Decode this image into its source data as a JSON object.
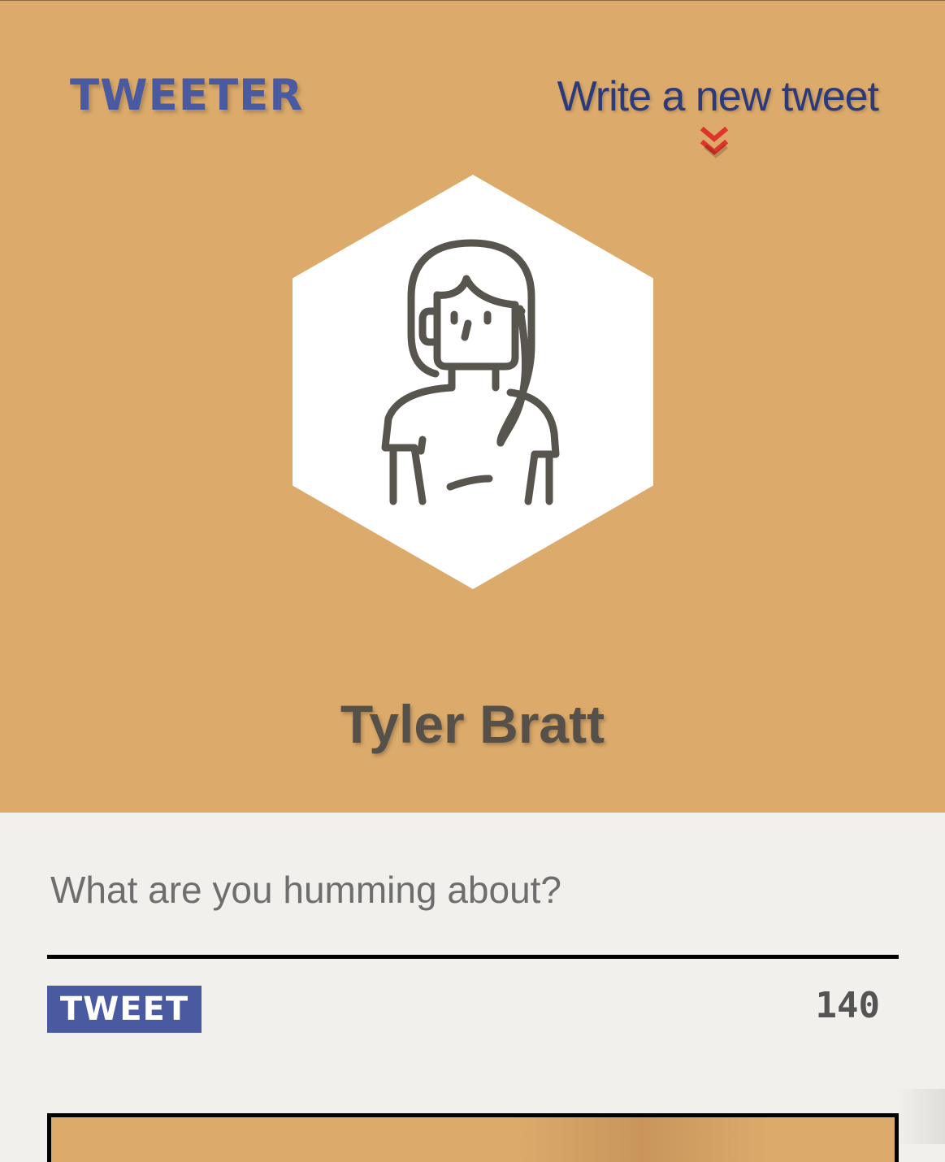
{
  "nav": {
    "logo": "TWEETER",
    "compose_link": "Write a new tweet",
    "compose_icon": "double-chevron-down-icon"
  },
  "profile": {
    "avatar_icon": "woman-avatar-icon",
    "name": "Tyler Bratt"
  },
  "composer": {
    "placeholder": "What are you humming about?",
    "value": "",
    "submit_label": "TWEET",
    "char_counter": "140"
  },
  "colors": {
    "header_bg": "#dcab6b",
    "page_bg": "#f2f0ec",
    "brand_blue": "#4a5aa0",
    "link_navy": "#2c3a7a",
    "chevron_red": "#e0342a",
    "name_gray": "#555049"
  }
}
